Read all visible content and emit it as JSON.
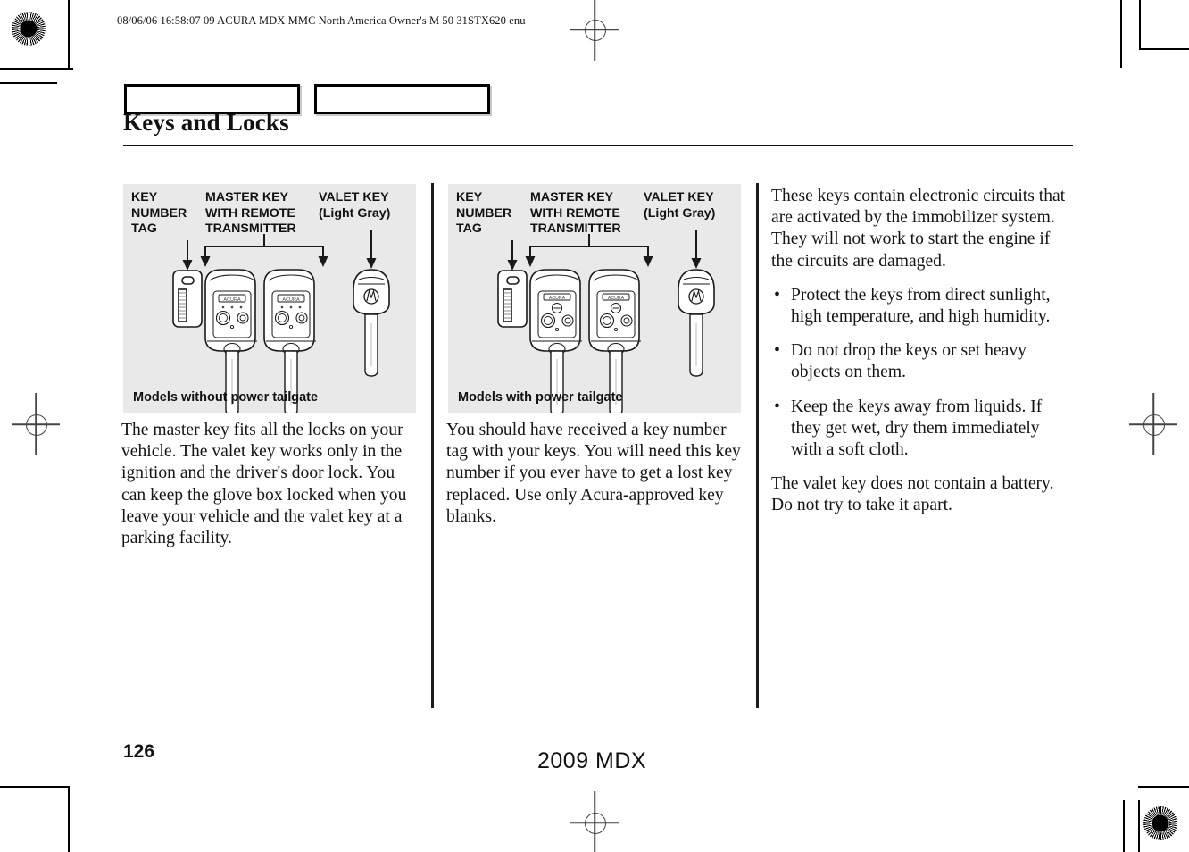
{
  "header": {
    "slug": "08/06/06 16:58:07   09 ACURA MDX MMC North America Owner's M 50 31STX620 enu"
  },
  "chapter": {
    "title": "Keys and Locks"
  },
  "figures": [
    {
      "id": "models-without-power-tailgate",
      "caption": "Models without power tailgate",
      "labels": {
        "key_number_tag": "KEY\nNUMBER\nTAG",
        "master_key": "MASTER KEY\nWITH REMOTE\nTRANSMITTER",
        "valet_key": "VALET KEY\n(Light Gray)"
      }
    },
    {
      "id": "models-with-power-tailgate",
      "caption": "Models with power tailgate",
      "labels": {
        "key_number_tag": "KEY\nNUMBER\nTAG",
        "master_key": "MASTER KEY\nWITH REMOTE\nTRANSMITTER",
        "valet_key": "VALET KEY\n(Light Gray)"
      }
    }
  ],
  "columns": {
    "left": {
      "paragraph": "The master key fits all the locks on your vehicle. The valet key works only in the ignition and the driver's door lock. You can keep the glove box locked when you leave your vehicle and the valet key at a parking facility."
    },
    "middle": {
      "paragraph": "You should have received a key number tag with your keys. You will need this key number if you ever have to get a lost key replaced. Use only Acura-approved key blanks."
    },
    "right": {
      "paragraph_1": "These keys contain electronic circuits that are activated by the immobilizer system. They will not work to start the engine if the circuits are damaged.",
      "bullets": [
        "Protect the keys from direct sunlight, high temperature, and high humidity.",
        "Do not drop the keys or set heavy objects on them.",
        "Keep the keys away from liquids. If they get wet, dry them immediately with a soft cloth."
      ],
      "paragraph_2": "The valet key does not contain a battery. Do not try to take it apart."
    }
  },
  "footer": {
    "page_number": "126",
    "model": "2009  MDX"
  },
  "colors": {
    "figure_background": "#e9e9e9",
    "text": "#141414",
    "rule": "#111111"
  }
}
